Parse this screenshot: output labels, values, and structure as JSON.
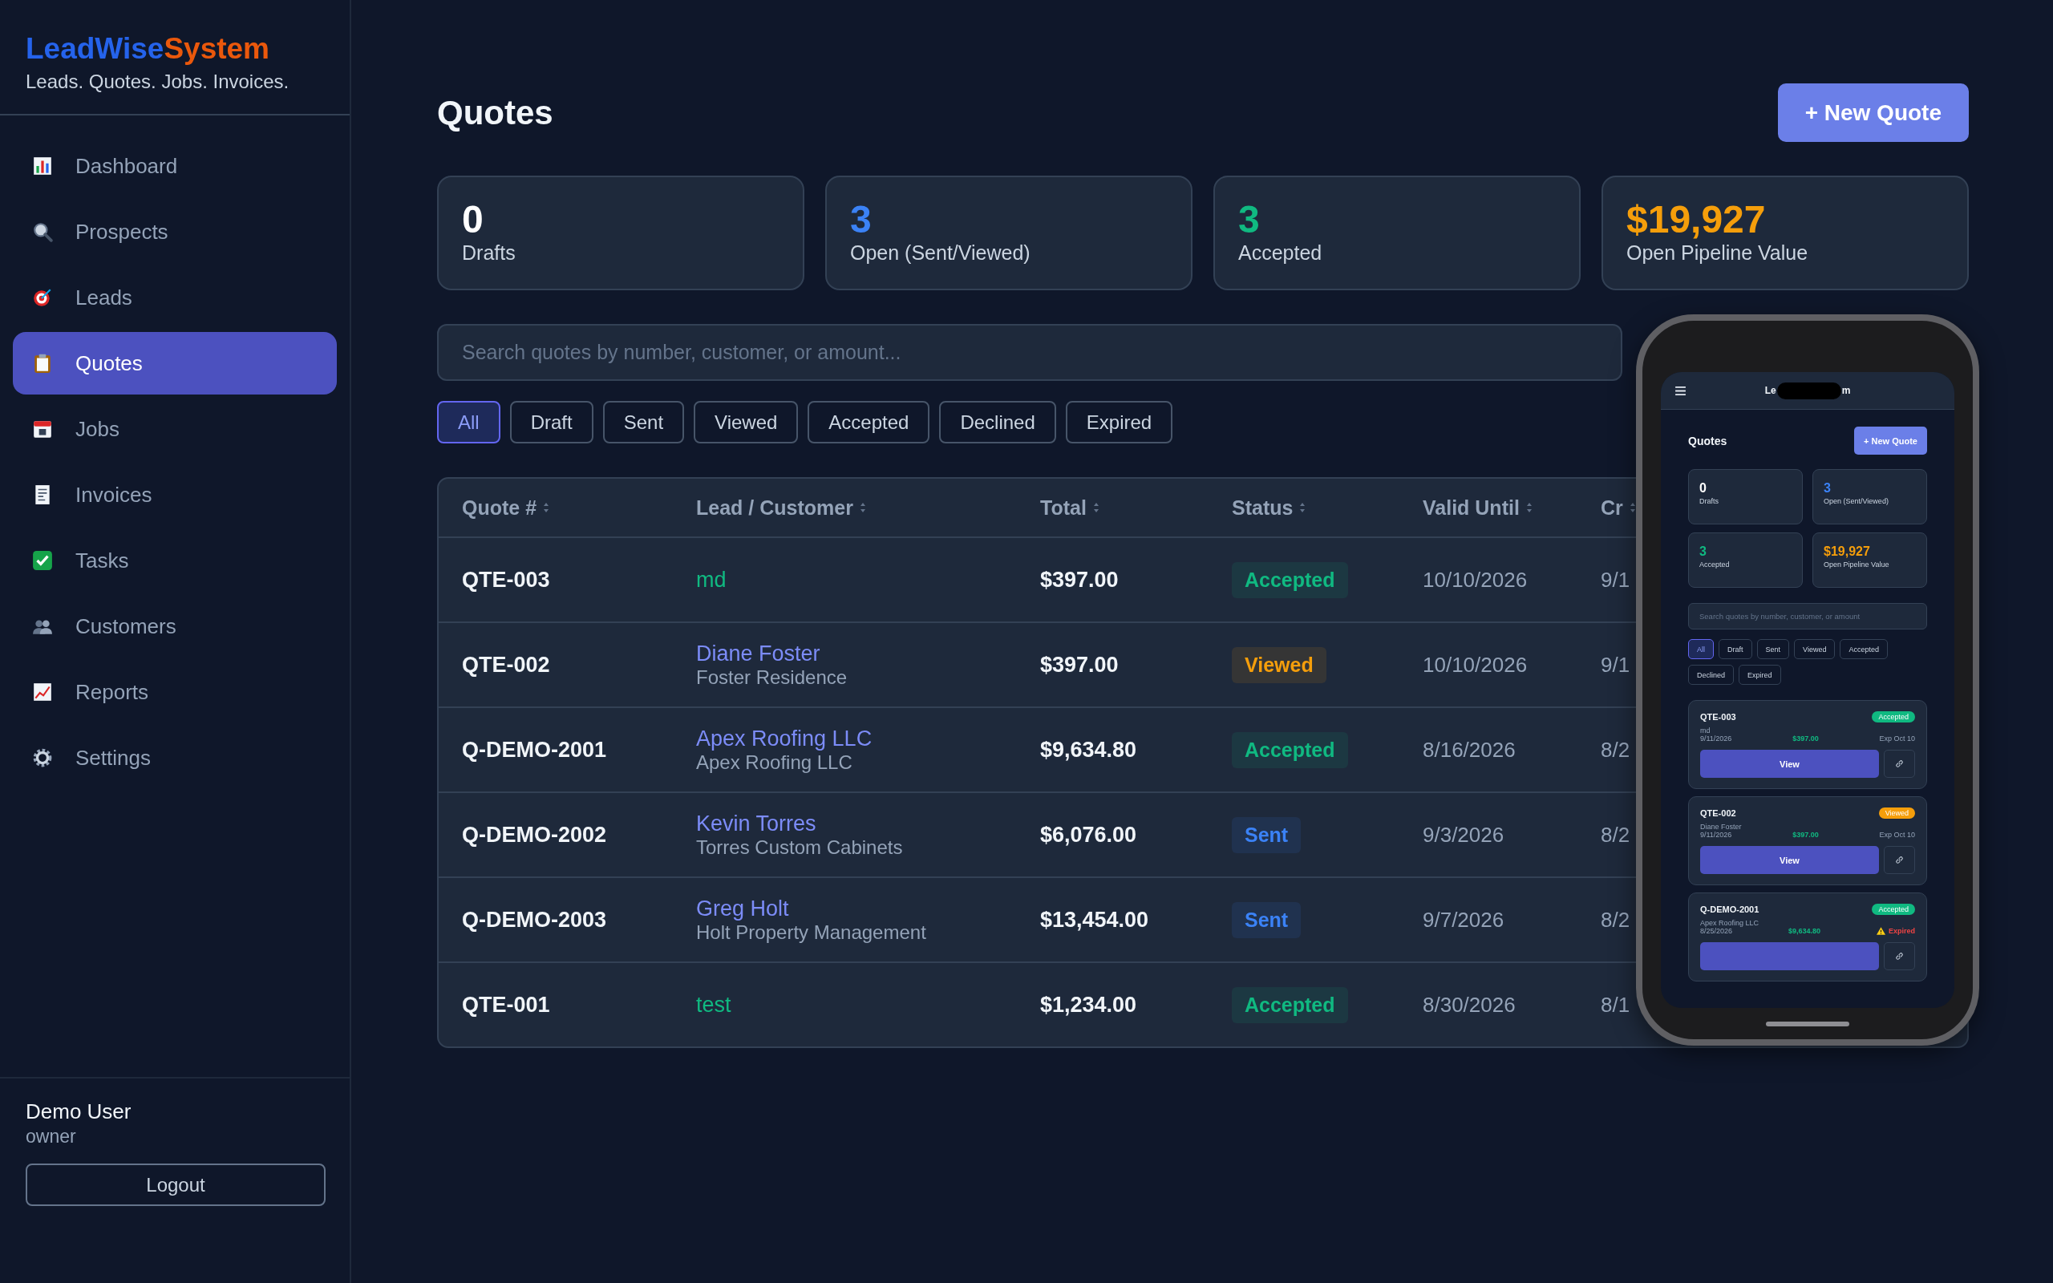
{
  "brand": {
    "name_first": "LeadWise",
    "name_second": "System",
    "tagline": "Leads. Quotes. Jobs. Invoices."
  },
  "nav": [
    {
      "label": "Dashboard",
      "selected": false
    },
    {
      "label": "Prospects",
      "selected": false
    },
    {
      "label": "Leads",
      "selected": false
    },
    {
      "label": "Quotes",
      "selected": true
    },
    {
      "label": "Jobs",
      "selected": false
    },
    {
      "label": "Invoices",
      "selected": false
    },
    {
      "label": "Tasks",
      "selected": false
    },
    {
      "label": "Customers",
      "selected": false
    },
    {
      "label": "Reports",
      "selected": false
    },
    {
      "label": "Settings",
      "selected": false
    }
  ],
  "user": {
    "name": "Demo User",
    "role": "owner",
    "logout": "Logout"
  },
  "page": {
    "title": "Quotes",
    "new_button": "+ New Quote"
  },
  "stats": [
    {
      "value": "0",
      "label": "Drafts",
      "color": "#ffffff"
    },
    {
      "value": "3",
      "label": "Open (Sent/Viewed)",
      "color": "#3b82f6"
    },
    {
      "value": "3",
      "label": "Accepted",
      "color": "#10b981"
    },
    {
      "value": "$19,927",
      "label": "Open Pipeline Value",
      "color": "#f59e0b"
    }
  ],
  "search": {
    "placeholder": "Search quotes by number, customer, or amount..."
  },
  "filters": [
    {
      "label": "All",
      "selected": true
    },
    {
      "label": "Draft",
      "selected": false
    },
    {
      "label": "Sent",
      "selected": false
    },
    {
      "label": "Viewed",
      "selected": false
    },
    {
      "label": "Accepted",
      "selected": false
    },
    {
      "label": "Declined",
      "selected": false
    },
    {
      "label": "Expired",
      "selected": false
    }
  ],
  "table": {
    "columns": [
      {
        "label": "Quote #"
      },
      {
        "label": "Lead / Customer"
      },
      {
        "label": "Total"
      },
      {
        "label": "Status"
      },
      {
        "label": "Valid Until"
      },
      {
        "label": "Cr"
      }
    ],
    "rows": [
      {
        "quote": "QTE-003",
        "kind": "lead",
        "name": "md",
        "total": "$397.00",
        "status": {
          "label": "Accepted",
          "color": "#10b981"
        },
        "valid_until": "10/10/2026",
        "column_6": "9/1"
      },
      {
        "quote": "QTE-002",
        "kind": "customer",
        "name": "Diane Foster",
        "company": "Foster Residence",
        "total": "$397.00",
        "status": {
          "label": "Viewed",
          "color": "#f59e0b"
        },
        "valid_until": "10/10/2026",
        "column_6": "9/1"
      },
      {
        "quote": "Q-DEMO-2001",
        "kind": "customer",
        "name": "Apex Roofing LLC",
        "company": "Apex Roofing LLC",
        "total": "$9,634.80",
        "status": {
          "label": "Accepted",
          "color": "#10b981"
        },
        "valid_until": "8/16/2026",
        "column_6": "8/2"
      },
      {
        "quote": "Q-DEMO-2002",
        "kind": "customer",
        "name": "Kevin Torres",
        "company": "Torres Custom Cabinets",
        "total": "$6,076.00",
        "status": {
          "label": "Sent",
          "color": "#3b82f6"
        },
        "valid_until": "9/3/2026",
        "column_6": "8/2"
      },
      {
        "quote": "Q-DEMO-2003",
        "kind": "customer",
        "name": "Greg Holt",
        "company": "Holt Property Management",
        "total": "$13,454.00",
        "status": {
          "label": "Sent",
          "color": "#3b82f6"
        },
        "valid_until": "9/7/2026",
        "column_6": "8/2"
      },
      {
        "quote": "QTE-001",
        "kind": "lead",
        "name": "test",
        "total": "$1,234.00",
        "status": {
          "label": "Accepted",
          "color": "#10b981"
        },
        "valid_until": "8/30/2026",
        "column_6": "8/1"
      }
    ]
  },
  "phone": {
    "title_parts": [
      "Le",
      "m"
    ],
    "heading": "Quotes",
    "new_button": "+ New Quote",
    "stats": [
      {
        "value": "0",
        "label": "Drafts",
        "color": "#ffffff"
      },
      {
        "value": "3",
        "label": "Open (Sent/Viewed)",
        "color": "#3b82f6"
      },
      {
        "value": "3",
        "label": "Accepted",
        "color": "#10b981"
      },
      {
        "value": "$19,927",
        "label": "Open Pipeline Value",
        "color": "#f59e0b"
      }
    ],
    "search_placeholder": "Search quotes by number, customer, or amount",
    "filters": [
      {
        "label": "All",
        "selected": true
      },
      {
        "label": "Draft",
        "selected": false
      },
      {
        "label": "Sent",
        "selected": false
      },
      {
        "label": "Viewed",
        "selected": false
      },
      {
        "label": "Accepted",
        "selected": false
      },
      {
        "label": "Declined",
        "selected": false
      },
      {
        "label": "Expired",
        "selected": false
      }
    ],
    "cards": [
      {
        "quote": "QTE-003",
        "status": {
          "label": "Accepted",
          "color": "#10b981"
        },
        "customer": "md",
        "date": "9/11/2026",
        "amount": "$397.00",
        "expiry": "Exp Oct 10",
        "expired": false,
        "button": "View"
      },
      {
        "quote": "QTE-002",
        "status": {
          "label": "Viewed",
          "color": "#f59e0b"
        },
        "customer": "Diane Foster",
        "date": "9/11/2026",
        "amount": "$397.00",
        "expiry": "Exp Oct 10",
        "expired": false,
        "button": "View"
      },
      {
        "quote": "Q-DEMO-2001",
        "status": {
          "label": "Accepted",
          "color": "#10b981"
        },
        "customer": "Apex Roofing LLC",
        "date": "8/25/2026",
        "amount": "$9,634.80",
        "expiry": "Expired",
        "expired": true
      }
    ]
  }
}
